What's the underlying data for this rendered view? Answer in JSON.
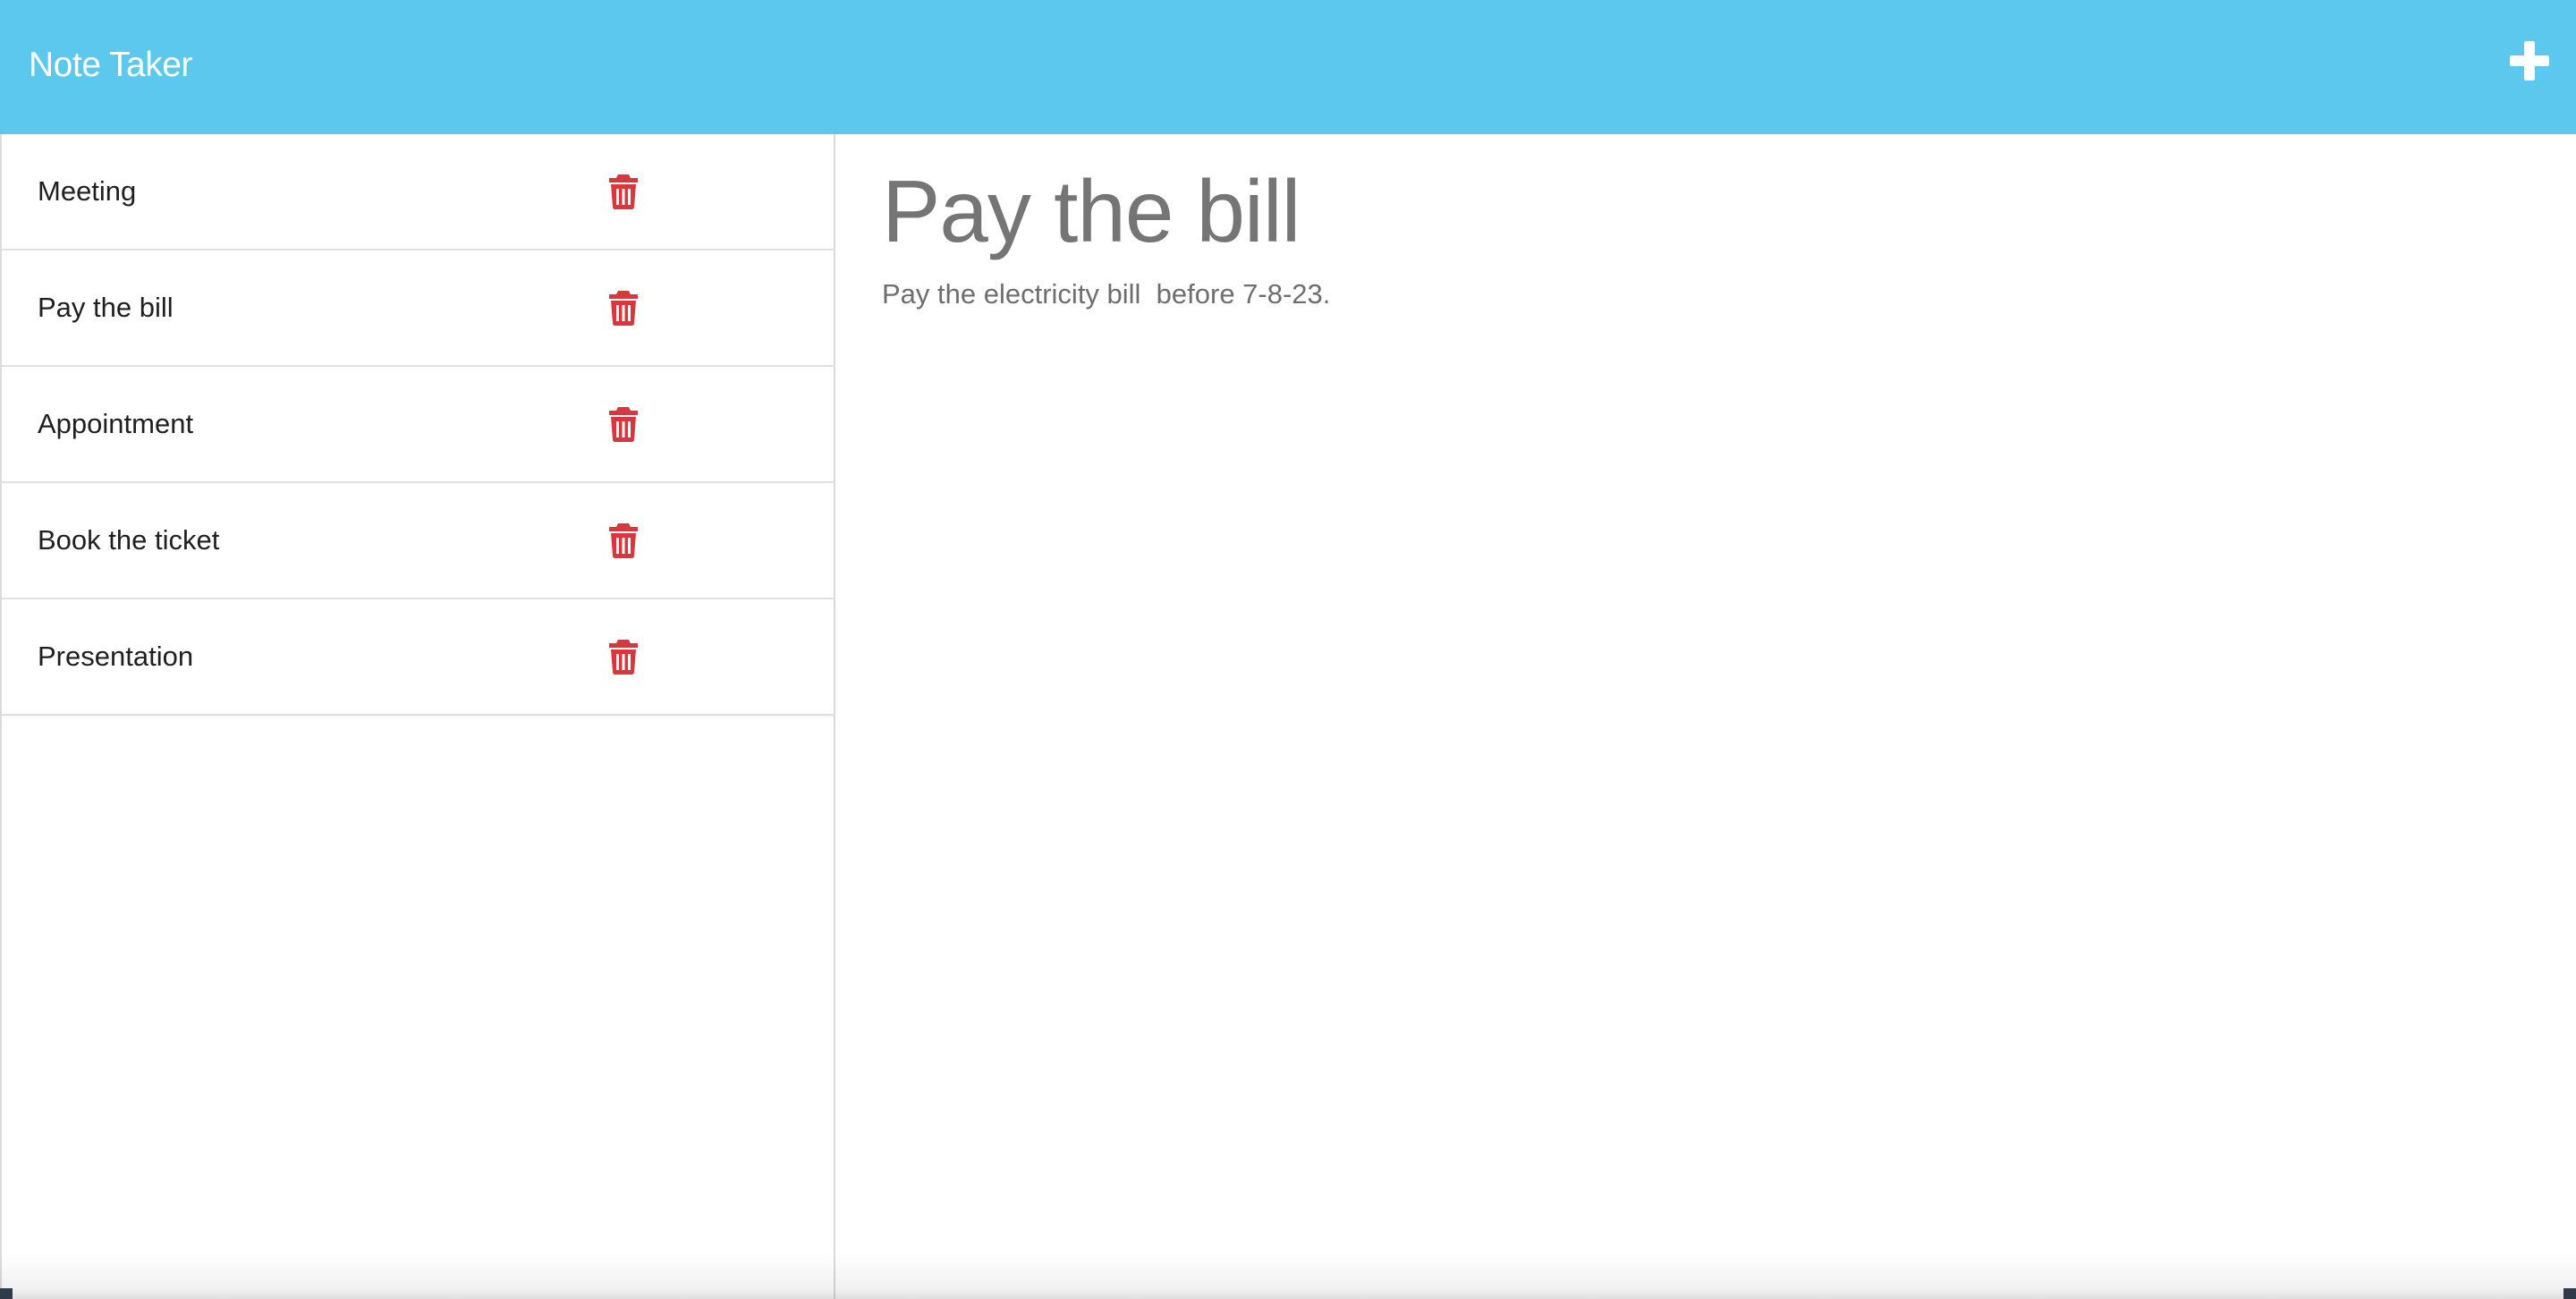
{
  "app": {
    "title": "Note Taker"
  },
  "header": {
    "new_note_icon": "plus-icon",
    "icon_color": "#ffffff",
    "background_color": "#5cc8ee"
  },
  "notes": [
    {
      "title": "Meeting",
      "delete_icon": "trash-icon"
    },
    {
      "title": "Pay the bill",
      "delete_icon": "trash-icon"
    },
    {
      "title": "Appointment",
      "delete_icon": "trash-icon"
    },
    {
      "title": "Book the ticket",
      "delete_icon": "trash-icon"
    },
    {
      "title": "Presentation",
      "delete_icon": "trash-icon"
    }
  ],
  "active_note": {
    "title": "Pay the bill",
    "text": "Pay the electricity bill  before 7-8-23."
  },
  "colors": {
    "delete_icon": "#d9363e",
    "title_text": "#757575",
    "body_text": "#6e6e6e"
  }
}
